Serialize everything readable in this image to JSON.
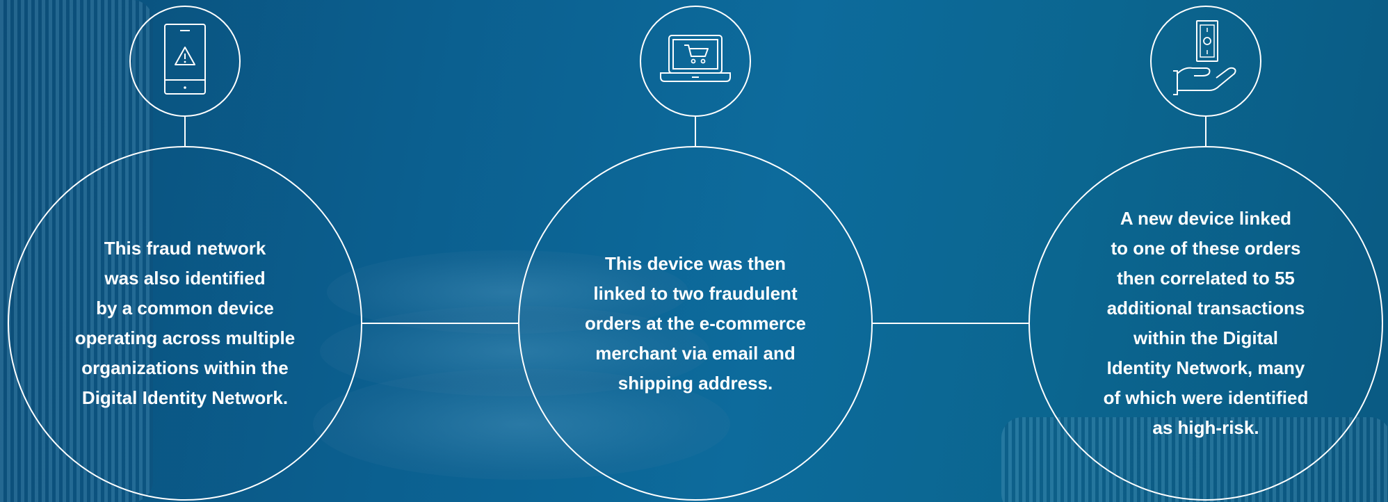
{
  "nodes": [
    {
      "icon": "mobile-alert-icon",
      "text": "This fraud network\nwas also identified\nby a common device\noperating across multiple\norganizations within the\nDigital Identity Network."
    },
    {
      "icon": "laptop-cart-icon",
      "text": "This device was then\nlinked to two fraudulent\norders at the e-commerce\nmerchant via email and\nshipping address."
    },
    {
      "icon": "hand-money-icon",
      "text": "A new device linked\nto one of these orders\nthen correlated to 55\nadditional transactions\nwithin the Digital\nIdentity Network, many\nof which were identified\nas high-risk."
    }
  ],
  "colors": {
    "line": "#ffffff",
    "text": "#ffffff",
    "background": "#0b5f8f"
  }
}
